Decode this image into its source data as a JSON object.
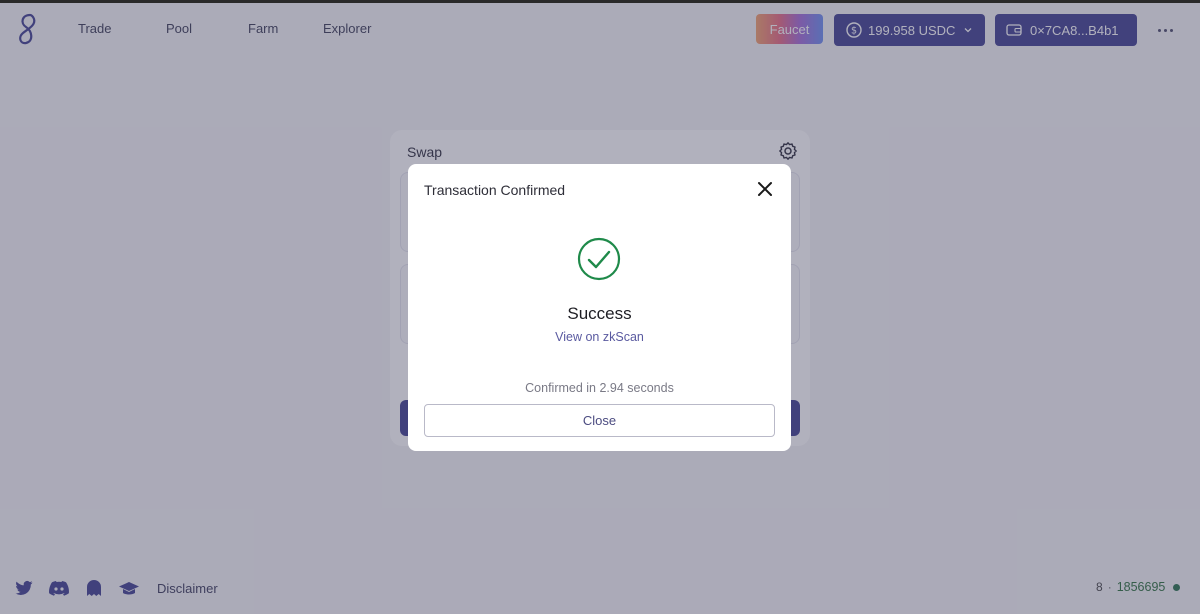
{
  "nav": {
    "items": [
      {
        "label": "Trade"
      },
      {
        "label": "Pool"
      },
      {
        "label": "Farm"
      },
      {
        "label": "Explorer"
      }
    ]
  },
  "header": {
    "faucet_label": "Faucet",
    "balance_label": "199.958 USDC",
    "wallet_label": "0×7CA8...B4b1"
  },
  "swap": {
    "title": "Swap"
  },
  "modal": {
    "title": "Transaction Confirmed",
    "status": "Success",
    "link": "View on zkScan",
    "confirmed_text": "Confirmed in 2.94 seconds",
    "close_label": "Close"
  },
  "footer": {
    "disclaimer": "Disclaimer",
    "block_prefix": "8",
    "block_sep": "·",
    "block_number": "1856695"
  },
  "icons": {
    "logo": "logo-icon",
    "usdc": "usdc-coin-icon",
    "chevron": "chevron-down-icon",
    "wallet": "wallet-icon",
    "more": "more-icon",
    "gear": "gear-icon",
    "close": "close-icon",
    "success": "check-circle-icon",
    "twitter": "twitter-icon",
    "discord": "discord-icon",
    "ghost": "ghost-icon",
    "docs": "docs-icon"
  },
  "colors": {
    "accent": "#3f3f8f",
    "success": "#1f8a4a",
    "link": "#5a5aa0",
    "status_dot": "#26704a"
  }
}
